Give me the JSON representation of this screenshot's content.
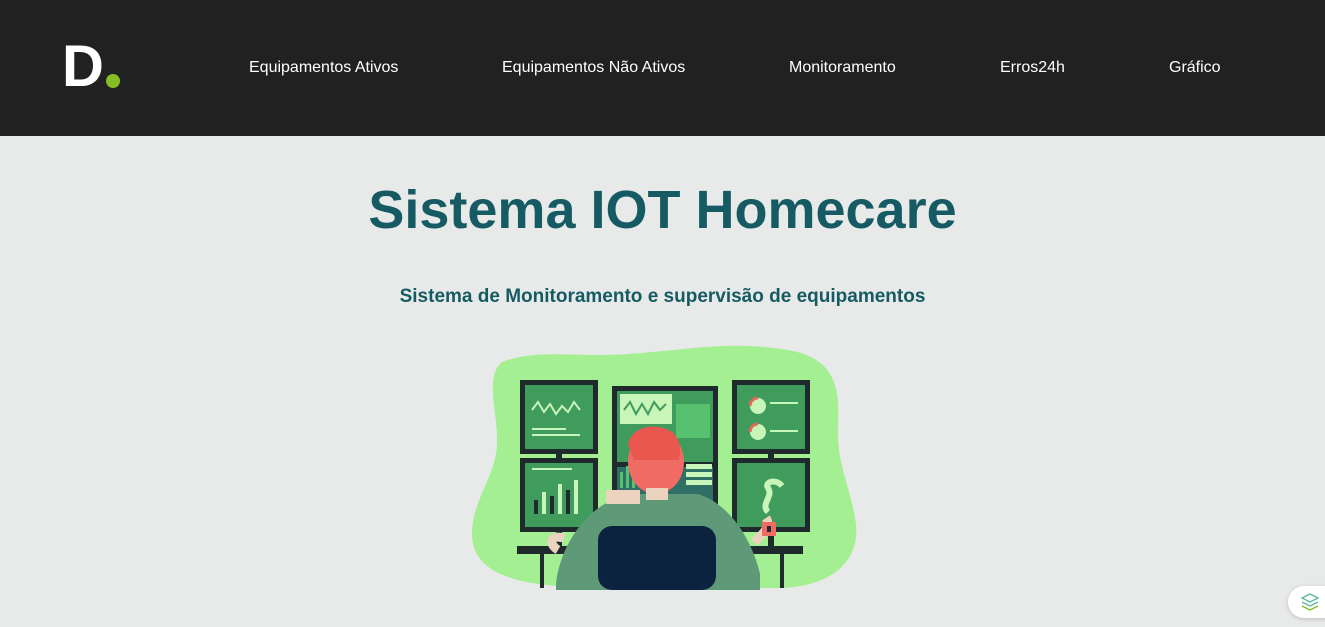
{
  "brand": {
    "logo_text": "D"
  },
  "nav": {
    "items": [
      {
        "label": "Equipamentos Ativos"
      },
      {
        "label": "Equipamentos Não Ativos"
      },
      {
        "label": "Monitoramento"
      },
      {
        "label": "Erros24h"
      },
      {
        "label": "Gráfico"
      }
    ]
  },
  "hero": {
    "title": "Sistema IOT Homecare",
    "subtitle": "Sistema de Monitoramento e supervisão de equipamentos"
  },
  "colors": {
    "header_bg": "#212121",
    "page_bg": "#e8e9e9",
    "heading": "#165b63",
    "brand_dot": "#86bc25",
    "illustration_blob": "#a3ef91"
  },
  "icons": {
    "illustration": "person-monitoring-screens-illustration",
    "widget": "cube-layers-icon"
  }
}
